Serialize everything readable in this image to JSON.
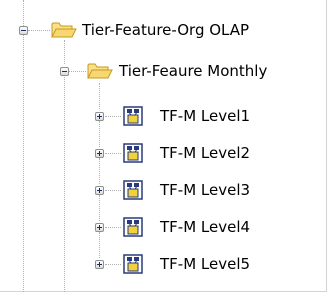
{
  "tree": {
    "root": {
      "label": "Tier-Feature-Org OLAP",
      "expanded": true,
      "icon": "folder-open-icon"
    },
    "folder": {
      "label": "Tier-Feaure Monthly",
      "expanded": true,
      "icon": "folder-open-icon"
    },
    "levels": [
      {
        "label": "TF-M Level1",
        "expanded": false,
        "icon": "cube-hierarchy-icon"
      },
      {
        "label": "TF-M Level2",
        "expanded": false,
        "icon": "cube-hierarchy-icon"
      },
      {
        "label": "TF-M Level3",
        "expanded": false,
        "icon": "cube-hierarchy-icon"
      },
      {
        "label": "TF-M Level4",
        "expanded": false,
        "icon": "cube-hierarchy-icon"
      },
      {
        "label": "TF-M Level5",
        "expanded": false,
        "icon": "cube-hierarchy-icon"
      }
    ],
    "colors": {
      "folder_fill": "#f7d774",
      "folder_stroke": "#c89a1a",
      "cube_frame": "#2a3a7a",
      "cube_fill": "#f2d23a",
      "connector": "#b0b0b0"
    }
  }
}
